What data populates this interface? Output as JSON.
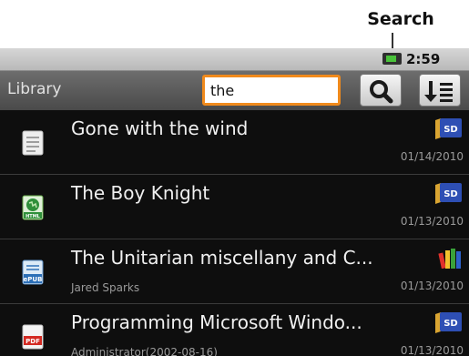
{
  "callout": {
    "label": "Search"
  },
  "status_bar": {
    "time": "2:59 AM",
    "icon": "battery-icon"
  },
  "header": {
    "title": "Library",
    "search": {
      "value": "the",
      "placeholder": ""
    },
    "search_button_icon": "magnifier-icon",
    "sort_button_icon": "sort-icon"
  },
  "books": [
    {
      "title": "Gone with the wind",
      "subtitle": "",
      "date": "01/14/2010",
      "type_icon": "text-file-icon",
      "source": "SD"
    },
    {
      "title": "The Boy Knight",
      "subtitle": "",
      "date": "01/13/2010",
      "type_icon": "html-file-icon",
      "source": "SD"
    },
    {
      "title": "The Unitarian miscellany and C...",
      "subtitle": "Jared Sparks",
      "date": "01/13/2010",
      "type_icon": "epub-file-icon",
      "source": "library-books-icon"
    },
    {
      "title": "Programming Microsoft Windo...",
      "subtitle": "Administrator(2002-08-16)",
      "date": "01/13/2010",
      "type_icon": "pdf-file-icon",
      "source": "SD"
    }
  ],
  "colors": {
    "accent": "#f08a1c",
    "sd_badge": "#2e4fb4",
    "background": "#0e0e0e"
  }
}
